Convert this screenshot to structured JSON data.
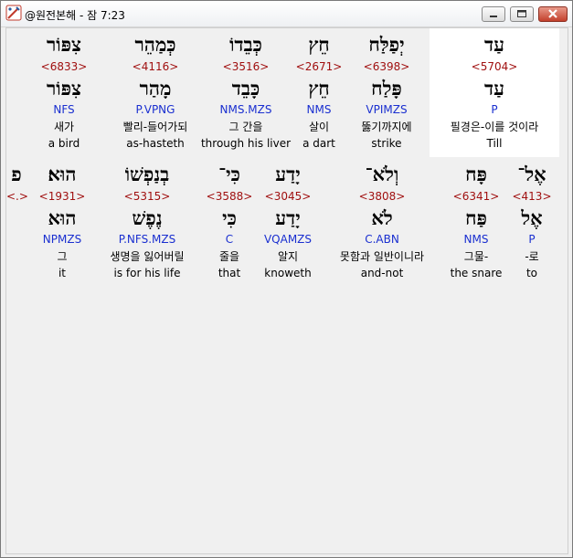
{
  "window": {
    "title": "@원전본해 - 잠 7:23",
    "icon": "app-pen-icon",
    "buttons": [
      "minimize-icon",
      "maximize-icon",
      "close-icon"
    ]
  },
  "colors": {
    "strong": "#a01010",
    "morph": "#1a2fd0",
    "highlight": "#ffffff"
  },
  "row1": [
    {
      "heb": "צִפּוֹר",
      "strong": "<6833>",
      "lemma": "צִפּוֹר",
      "morph": "NFS",
      "kor": "새가",
      "eng": "a bird"
    },
    {
      "heb": "כְּמַהֵר",
      "strong": "<4116>",
      "lemma": "מָהַר",
      "morph": "P.VPNG",
      "kor": "빨리-들어가되",
      "eng": "as-hasteth"
    },
    {
      "heb": "כְּבֵדוֹ",
      "strong": "<3516>",
      "lemma": "כָּבֵד",
      "morph": "NMS.MZS",
      "kor": "그 간을",
      "eng": "through his liver"
    },
    {
      "heb": "חֵץ",
      "strong": "<2671>",
      "lemma": "חֵץ",
      "morph": "NMS",
      "kor": "살이",
      "eng": "a dart"
    },
    {
      "heb": "יְפַלַּח",
      "strong": "<6398>",
      "lemma": "פָּלַח",
      "morph": "VPIMZS",
      "kor": "뚫기까지에",
      "eng": "strike"
    },
    {
      "heb": "עַד",
      "strong": "<5704>",
      "lemma": "עַד",
      "morph": "P",
      "kor": "필경은-이를 것이라",
      "eng": "Till"
    }
  ],
  "row2": [
    {
      "heb": "פ",
      "strong": "<.>",
      "lemma": "",
      "morph": "",
      "kor": "",
      "eng": ""
    },
    {
      "heb": "הוּא׃",
      "strong": "<1931>",
      "lemma": "הוּא",
      "morph": "NPMZS",
      "kor": "그",
      "eng": "it"
    },
    {
      "heb": "בְנַפְשׁוֹ",
      "strong": "<5315>",
      "lemma": "נֶפֶשׁ",
      "morph": "P.NFS.MZS",
      "kor": "생명을 잃어버릴",
      "eng": "is for his life"
    },
    {
      "heb": "כִּי־",
      "strong": "<3588>",
      "lemma": "כִּי",
      "morph": "C",
      "kor": "줄을",
      "eng": "that"
    },
    {
      "heb": "יָדַע",
      "strong": "<3045>",
      "lemma": "יָדַע",
      "morph": "VQAMZS",
      "kor": "알지",
      "eng": "knoweth"
    },
    {
      "heb": "וְלֹא־",
      "strong": "<3808>",
      "lemma": "לֹא",
      "morph": "C.ABN",
      "kor": "못함과 일반이니라",
      "eng": "and-not"
    },
    {
      "heb": "פָּח",
      "strong": "<6341>",
      "lemma": "פַּח",
      "morph": "NMS",
      "kor": "그물-",
      "eng": "the snare"
    },
    {
      "heb": "אֶל־",
      "strong": "<413>",
      "lemma": "אֶל",
      "morph": "P",
      "kor": "-로",
      "eng": "to"
    }
  ]
}
